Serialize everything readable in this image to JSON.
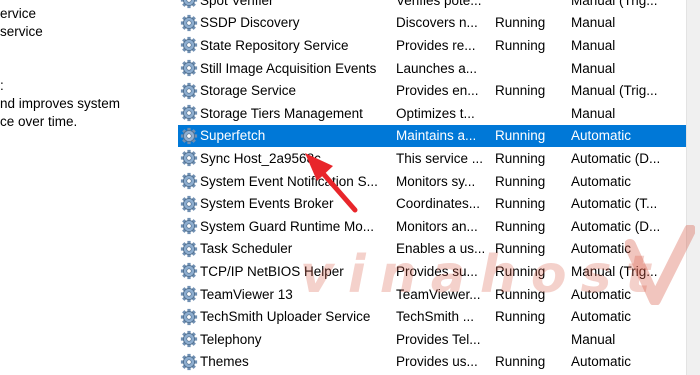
{
  "left_panel": {
    "lines": [
      "ervice",
      "service",
      ":",
      "nd improves system",
      "ce over time."
    ]
  },
  "services": [
    {
      "name": "Spot Verifier",
      "description": "Verifies pote...",
      "status": "",
      "startup": "Manual (Trig..."
    },
    {
      "name": "SSDP Discovery",
      "description": "Discovers n...",
      "status": "Running",
      "startup": "Manual"
    },
    {
      "name": "State Repository Service",
      "description": "Provides re...",
      "status": "Running",
      "startup": "Manual"
    },
    {
      "name": "Still Image Acquisition Events",
      "description": "Launches a...",
      "status": "",
      "startup": "Manual"
    },
    {
      "name": "Storage Service",
      "description": "Provides en...",
      "status": "Running",
      "startup": "Manual (Trig..."
    },
    {
      "name": "Storage Tiers Management",
      "description": "Optimizes t...",
      "status": "",
      "startup": "Manual"
    },
    {
      "name": "Superfetch",
      "description": "Maintains a...",
      "status": "Running",
      "startup": "Automatic",
      "selected": true
    },
    {
      "name": "Sync Host_2a9568c",
      "description": "This service ...",
      "status": "Running",
      "startup": "Automatic (D..."
    },
    {
      "name": "System Event Notification S...",
      "description": "Monitors sy...",
      "status": "Running",
      "startup": "Automatic"
    },
    {
      "name": "System Events Broker",
      "description": "Coordinates...",
      "status": "Running",
      "startup": "Automatic (T..."
    },
    {
      "name": "System Guard Runtime Mo...",
      "description": "Monitors an...",
      "status": "Running",
      "startup": "Automatic (D..."
    },
    {
      "name": "Task Scheduler",
      "description": "Enables a us...",
      "status": "Running",
      "startup": "Automatic"
    },
    {
      "name": "TCP/IP NetBIOS Helper",
      "description": "Provides su...",
      "status": "Running",
      "startup": "Manual (Trig..."
    },
    {
      "name": "TeamViewer 13",
      "description": "TeamViewer...",
      "status": "Running",
      "startup": "Automatic"
    },
    {
      "name": "TechSmith Uploader Service",
      "description": "TechSmith ...",
      "status": "Running",
      "startup": "Automatic"
    },
    {
      "name": "Telephony",
      "description": "Provides Tel...",
      "status": "",
      "startup": "Manual"
    },
    {
      "name": "Themes",
      "description": "Provides us...",
      "status": "Running",
      "startup": "Automatic"
    }
  ],
  "watermark": {
    "text": "vinahost"
  },
  "colors": {
    "selection": "#0078d7",
    "arrow": "#e8262b",
    "watermark": "#d75a46"
  },
  "icons": {
    "row_icon": "gear-icon",
    "annotation": "red-arrow"
  }
}
